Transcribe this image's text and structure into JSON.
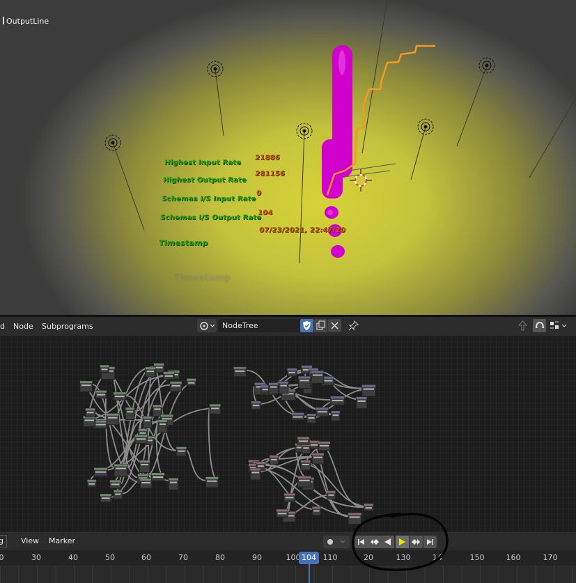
{
  "viewport": {
    "object_name": "OutputLine",
    "scene_text": {
      "labels": [
        "Highest Input Rate",
        "Highest Output Rate",
        "Schemas I/S Input Rate",
        "Schemas I/S Output Rate",
        "Timestamp"
      ],
      "values": [
        "21886",
        "281156",
        "0",
        "104",
        "07/23/2021, 22:47:20"
      ],
      "ghost_labels": [
        "Timestamp"
      ]
    },
    "colors": {
      "magenta_bar": "#d200cc",
      "orange_line": "#f39a22",
      "green_text": "#2e9a1a",
      "orange_text": "#b75a0a"
    }
  },
  "node_editor": {
    "menu": [
      "d",
      "Node",
      "Subprograms"
    ],
    "tree_name": "NodeTree",
    "icons": [
      "node-tree-icon",
      "fake-user-shield-icon",
      "duplicate-icon",
      "close-icon",
      "pin-icon",
      "parent-tree-icon",
      "snap-icon",
      "overlay-icon"
    ]
  },
  "timeline": {
    "menu": [
      "g",
      "View",
      "Marker"
    ],
    "current_frame": "104",
    "ticks": [
      "0",
      "30",
      "40",
      "50",
      "60",
      "70",
      "80",
      "90",
      "100",
      "110",
      "20",
      "130",
      "14",
      "150",
      "160",
      "170"
    ],
    "playback_buttons": [
      "jump-start",
      "prev-keyframe",
      "play-reverse",
      "play",
      "next-keyframe",
      "jump-end"
    ]
  }
}
